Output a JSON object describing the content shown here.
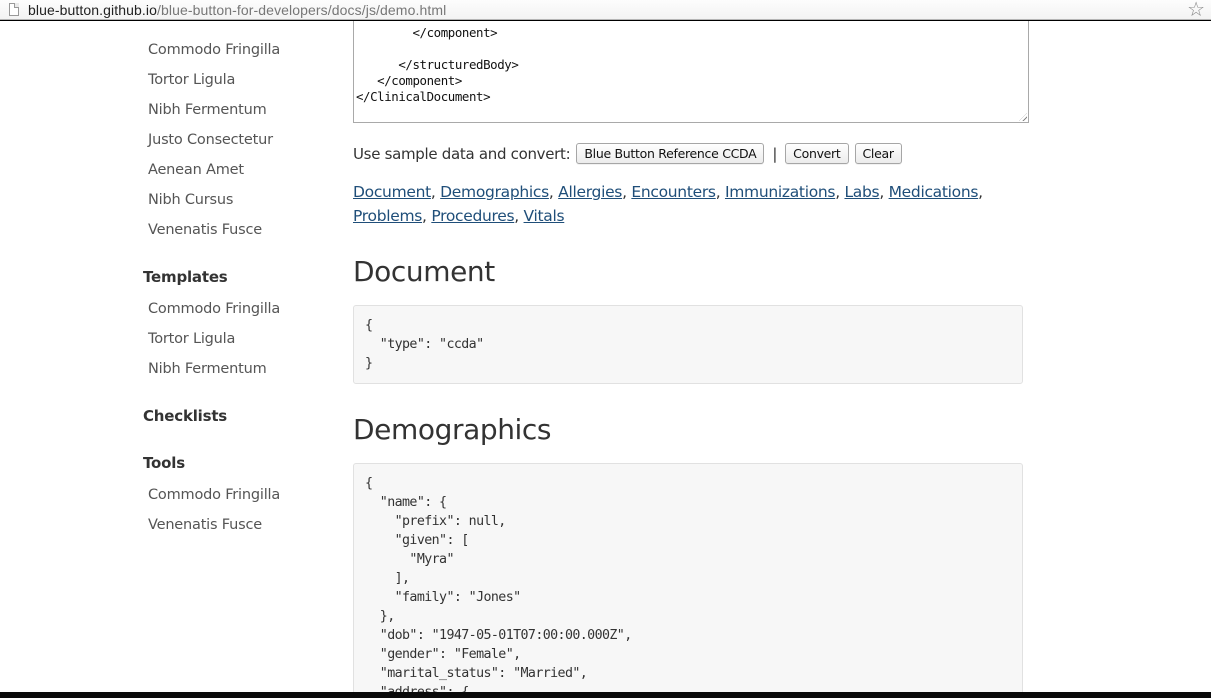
{
  "browser": {
    "url_host": "blue-button.github.io",
    "url_path": "/blue-button-for-developers/docs/js/demo.html",
    "bookmark_icon": "star-icon"
  },
  "sidebar": {
    "group1_items": [
      {
        "label": "Commodo Fringilla"
      },
      {
        "label": "Tortor Ligula"
      },
      {
        "label": "Nibh Fermentum"
      },
      {
        "label": "Justo Consectetur"
      },
      {
        "label": "Aenean Amet"
      },
      {
        "label": "Nibh Cursus"
      },
      {
        "label": "Venenatis Fusce"
      }
    ],
    "templates": {
      "heading": "Templates",
      "items": [
        {
          "label": "Commodo Fringilla"
        },
        {
          "label": "Tortor Ligula"
        },
        {
          "label": "Nibh Fermentum"
        }
      ]
    },
    "checklists": {
      "heading": "Checklists"
    },
    "tools": {
      "heading": "Tools",
      "items": [
        {
          "label": "Commodo Fringilla"
        },
        {
          "label": "Venenatis Fusce"
        }
      ]
    }
  },
  "input": {
    "xml_value": "        </component>\n\n      </structuredBody>\n   </component>\n</ClinicalDocument>"
  },
  "controls": {
    "sample_label": "Use sample data and convert:",
    "sample_button": "Blue Button Reference CCDA",
    "separator": "|",
    "convert_button": "Convert",
    "clear_button": "Clear"
  },
  "toc": {
    "links": [
      "Document",
      "Demographics",
      "Allergies",
      "Encounters",
      "Immunizations",
      "Labs",
      "Medications",
      "Problems",
      "Procedures",
      "Vitals"
    ],
    "separator": ", "
  },
  "sections": {
    "document": {
      "title": "Document",
      "code": "{\n  \"type\": \"ccda\"\n}"
    },
    "demographics": {
      "title": "Demographics",
      "code": "{\n  \"name\": {\n    \"prefix\": null,\n    \"given\": [\n      \"Myra\"\n    ],\n    \"family\": \"Jones\"\n  },\n  \"dob\": \"1947-05-01T07:00:00.000Z\",\n  \"gender\": \"Female\",\n  \"marital_status\": \"Married\",\n  \"address\": {"
    }
  },
  "colors": {
    "link": "#1f4e79",
    "text": "#333333",
    "code_bg": "#f7f7f7"
  }
}
